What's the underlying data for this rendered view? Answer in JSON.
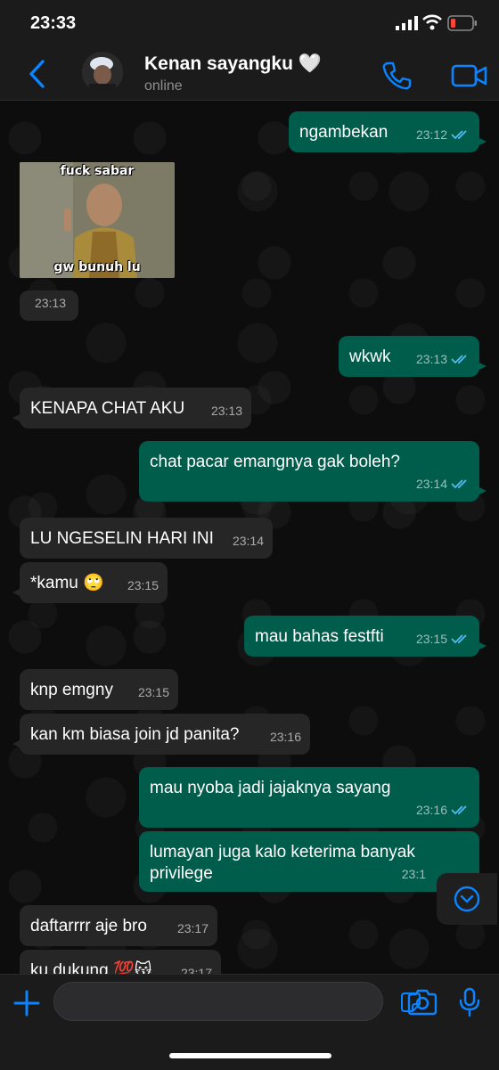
{
  "status_bar": {
    "time": "23:33"
  },
  "header": {
    "contact_name": "Kenan sayangku 🤍",
    "contact_status": "online",
    "icons": [
      "back-chevron-icon",
      "phone-icon",
      "video-call-icon"
    ]
  },
  "image_message": {
    "caption_top": "fuck sabar",
    "caption_bottom": "gw bunuh lu",
    "time": "23:13"
  },
  "messages": [
    {
      "text": "ngambekan",
      "time": "23:12"
    },
    {
      "text": "wkwk",
      "time": "23:13"
    },
    {
      "text": "KENAPA CHAT AKU",
      "time": "23:13"
    },
    {
      "text": "chat pacar emangnya gak boleh?",
      "time": "23:14"
    },
    {
      "text": "LU NGESELIN HARI INI",
      "time": "23:14"
    },
    {
      "text": "*kamu 🙄",
      "time": "23:15"
    },
    {
      "text": "mau bahas festfti",
      "time": "23:15"
    },
    {
      "text": "knp emgny",
      "time": "23:15"
    },
    {
      "text": "kan km biasa join jd panita?",
      "time": "23:16"
    },
    {
      "text": "mau nyoba jadi jajaknya sayang",
      "time": "23:16"
    },
    {
      "text": "lumayan juga kalo keterima banyak privilege",
      "time": "23:1"
    },
    {
      "text": "daftarrrr aje bro",
      "time": "23:17"
    },
    {
      "text": "ku dukung 💯😽",
      "time": "23:17"
    }
  ],
  "input": {
    "placeholder": ""
  },
  "colors": {
    "accent": "#0a84ff",
    "outgoing": "#005c4b",
    "incoming": "#262626",
    "read_ticks": "#53bdeb"
  }
}
